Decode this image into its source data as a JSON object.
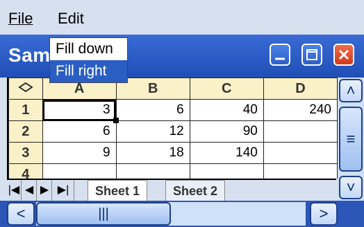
{
  "menubar": {
    "items": [
      {
        "label": "File",
        "underline": "F"
      },
      {
        "label": "Edit",
        "underline": "E"
      }
    ]
  },
  "window": {
    "title": "Sam  s",
    "buttons": [
      "minimize-icon",
      "maximize-icon",
      "close-icon"
    ]
  },
  "dropdown": {
    "items": [
      {
        "label": "Fill down",
        "selected": false
      },
      {
        "label": "Fill right",
        "selected": true
      }
    ]
  },
  "grid": {
    "corner_icon": "diamond-icon",
    "columns": [
      "A",
      "B",
      "C",
      "D"
    ],
    "rows": [
      {
        "header": "1",
        "cells": [
          "3",
          "6",
          "40",
          "240"
        ]
      },
      {
        "header": "2",
        "cells": [
          "6",
          "12",
          "90",
          ""
        ]
      },
      {
        "header": "3",
        "cells": [
          "9",
          "18",
          "140",
          ""
        ]
      },
      {
        "header": "4",
        "cells": [
          "",
          "",
          "",
          ""
        ]
      }
    ],
    "active_cell": "A1"
  },
  "sheets": {
    "tabs": [
      "Sheet 1",
      "Sheet 2"
    ],
    "active": "Sheet 1"
  },
  "colors": {
    "titlebar": "#2a5ec2",
    "header_bg": "#fbf1c9",
    "selection": "#2a5ec2"
  }
}
